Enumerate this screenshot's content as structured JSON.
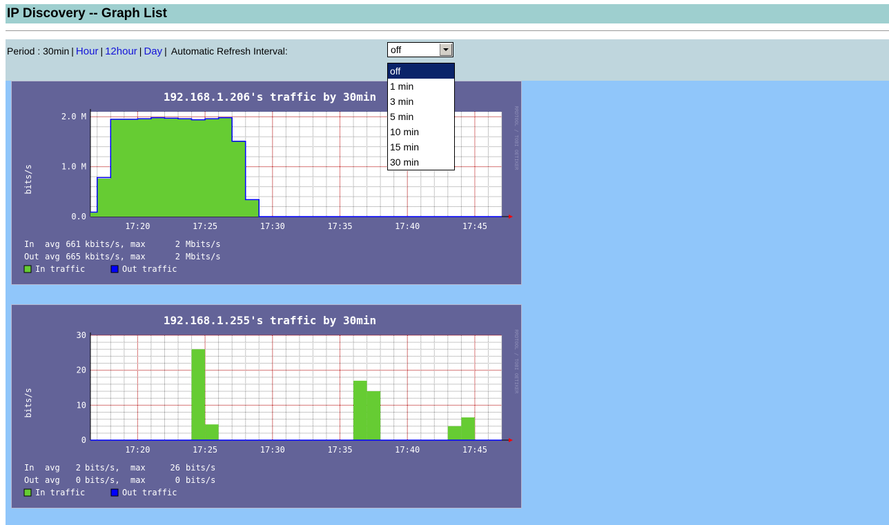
{
  "page": {
    "title": "IP Discovery -- Graph List"
  },
  "period": {
    "label": "Period : ",
    "current": "30min",
    "links": [
      "Hour",
      "12hour",
      "Day"
    ],
    "refresh_label": "Automatic Refresh Interval:"
  },
  "refresh_select": {
    "selected": "off",
    "options": [
      "off",
      "1 min",
      "3 min",
      "5 min",
      "10 min",
      "15 min",
      "30 min"
    ]
  },
  "colors": {
    "in_traffic": "#66cc33",
    "out_traffic": "#0000ff",
    "graph_bg": "#636398",
    "grid_major": "#c00000",
    "grid_minor": "#909090"
  },
  "watermark": "RRDTOOL / TOBI OETIKER",
  "graphs": [
    {
      "title": "192.168.1.206's traffic by 30min",
      "ylabel": "bits/s",
      "y_ticks": [
        "0.0",
        "1.0 M",
        "2.0 M"
      ],
      "x_ticks": [
        "17:20",
        "17:25",
        "17:30",
        "17:35",
        "17:40",
        "17:45"
      ],
      "stats": [
        {
          "name": "In",
          "avg": "661",
          "avg_unit": "kbits/s,",
          "max": "2",
          "max_unit": "Mbits/s"
        },
        {
          "name": "Out",
          "avg": "665",
          "avg_unit": "kbits/s,",
          "max": "2",
          "max_unit": "Mbits/s"
        }
      ],
      "legend": [
        "In traffic",
        "Out traffic"
      ]
    },
    {
      "title": "192.168.1.255's traffic by 30min",
      "ylabel": "bits/s",
      "y_ticks": [
        "0",
        "10",
        "20",
        "30"
      ],
      "x_ticks": [
        "17:20",
        "17:25",
        "17:30",
        "17:35",
        "17:40",
        "17:45"
      ],
      "stats": [
        {
          "name": "In",
          "avg": "2",
          "avg_unit": "bits/s,",
          "max": "26",
          "max_unit": "bits/s"
        },
        {
          "name": "Out",
          "avg": "0",
          "avg_unit": "bits/s,",
          "max": "0",
          "max_unit": "bits/s"
        }
      ],
      "legend": [
        "In traffic",
        "Out traffic"
      ]
    }
  ],
  "chart_data": [
    {
      "type": "area",
      "title": "192.168.1.206's traffic by 30min",
      "ylabel": "bits/s",
      "ylim": [
        0,
        2100000
      ],
      "x_unit": "minutes",
      "x_range": [
        "17:16:30",
        "17:47"
      ],
      "series": [
        {
          "name": "In traffic",
          "points": [
            [
              "17:16:30",
              80000
            ],
            [
              "17:17",
              760000
            ],
            [
              "17:18",
              1940000
            ],
            [
              "17:19",
              1940000
            ],
            [
              "17:20",
              1950000
            ],
            [
              "17:21",
              1970000
            ],
            [
              "17:22",
              1960000
            ],
            [
              "17:23",
              1950000
            ],
            [
              "17:24",
              1930000
            ],
            [
              "17:25",
              1950000
            ],
            [
              "17:26",
              1970000
            ],
            [
              "17:27",
              1500000
            ],
            [
              "17:28",
              330000
            ],
            [
              "17:29",
              0
            ],
            [
              "17:47",
              0
            ]
          ]
        },
        {
          "name": "Out traffic",
          "points": [
            [
              "17:16:30",
              90000
            ],
            [
              "17:17",
              780000
            ],
            [
              "17:18",
              1950000
            ],
            [
              "17:19",
              1950000
            ],
            [
              "17:20",
              1960000
            ],
            [
              "17:21",
              1980000
            ],
            [
              "17:22",
              1970000
            ],
            [
              "17:23",
              1960000
            ],
            [
              "17:24",
              1940000
            ],
            [
              "17:25",
              1960000
            ],
            [
              "17:26",
              1980000
            ],
            [
              "17:27",
              1510000
            ],
            [
              "17:28",
              340000
            ],
            [
              "17:29",
              0
            ],
            [
              "17:47",
              0
            ]
          ]
        }
      ]
    },
    {
      "type": "bar",
      "title": "192.168.1.255's traffic by 30min",
      "ylabel": "bits/s",
      "ylim": [
        0,
        30
      ],
      "series": [
        {
          "name": "In traffic",
          "bars": [
            [
              "17:24",
              26
            ],
            [
              "17:25",
              4.5
            ],
            [
              "17:36",
              17
            ],
            [
              "17:37",
              14
            ],
            [
              "17:43",
              4
            ],
            [
              "17:44",
              6.5
            ]
          ]
        },
        {
          "name": "Out traffic",
          "bars": []
        }
      ]
    }
  ]
}
